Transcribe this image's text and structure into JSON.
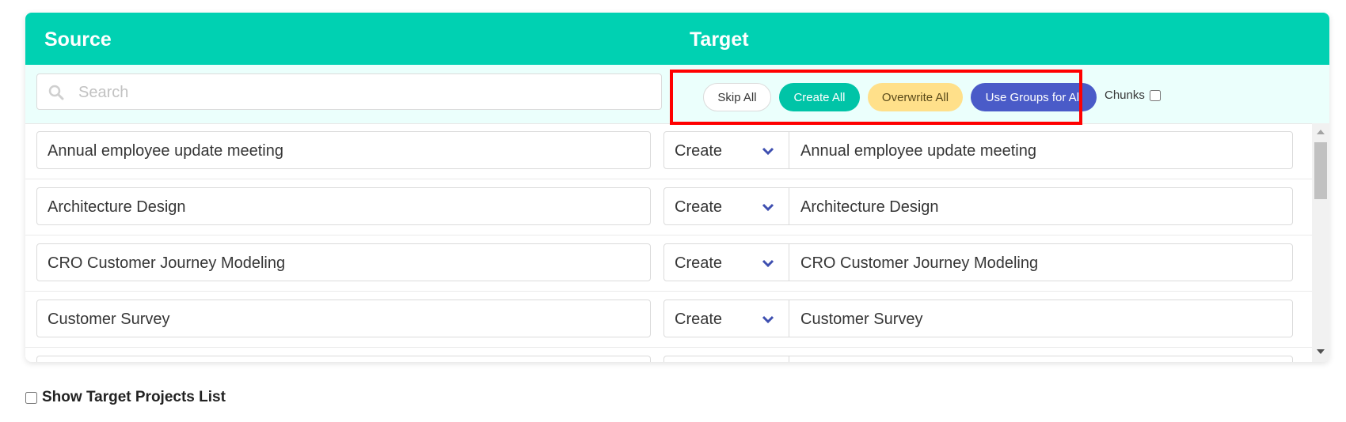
{
  "header": {
    "source_label": "Source",
    "target_label": "Target"
  },
  "search": {
    "placeholder": "Search",
    "value": ""
  },
  "bulk_actions": {
    "skip_all": "Skip All",
    "create_all": "Create All",
    "overwrite_all": "Overwrite All",
    "use_groups_for_all": "Use Groups for All",
    "chunks_label": "Chunks",
    "chunks_checked": false
  },
  "rows": [
    {
      "source": "Annual employee update meeting",
      "action": "Create",
      "target": "Annual employee update meeting"
    },
    {
      "source": "Architecture Design",
      "action": "Create",
      "target": "Architecture Design"
    },
    {
      "source": "CRO Customer Journey Modeling",
      "action": "Create",
      "target": "CRO Customer Journey Modeling"
    },
    {
      "source": "Customer Survey",
      "action": "Create",
      "target": "Customer Survey"
    },
    {
      "source": "",
      "action": "",
      "target": ""
    }
  ],
  "footer": {
    "show_target_projects_label": "Show Target Projects List",
    "checked": false
  },
  "colors": {
    "header": "#00d1b2",
    "toolbar_bg": "#ebfffc",
    "create": "#00c4a7",
    "overwrite": "#ffe08a",
    "groups": "#4a5bc8",
    "highlight": "#ff0000"
  },
  "icons": {
    "search": "search-icon",
    "select_arrow": "chevron-down-icon"
  }
}
